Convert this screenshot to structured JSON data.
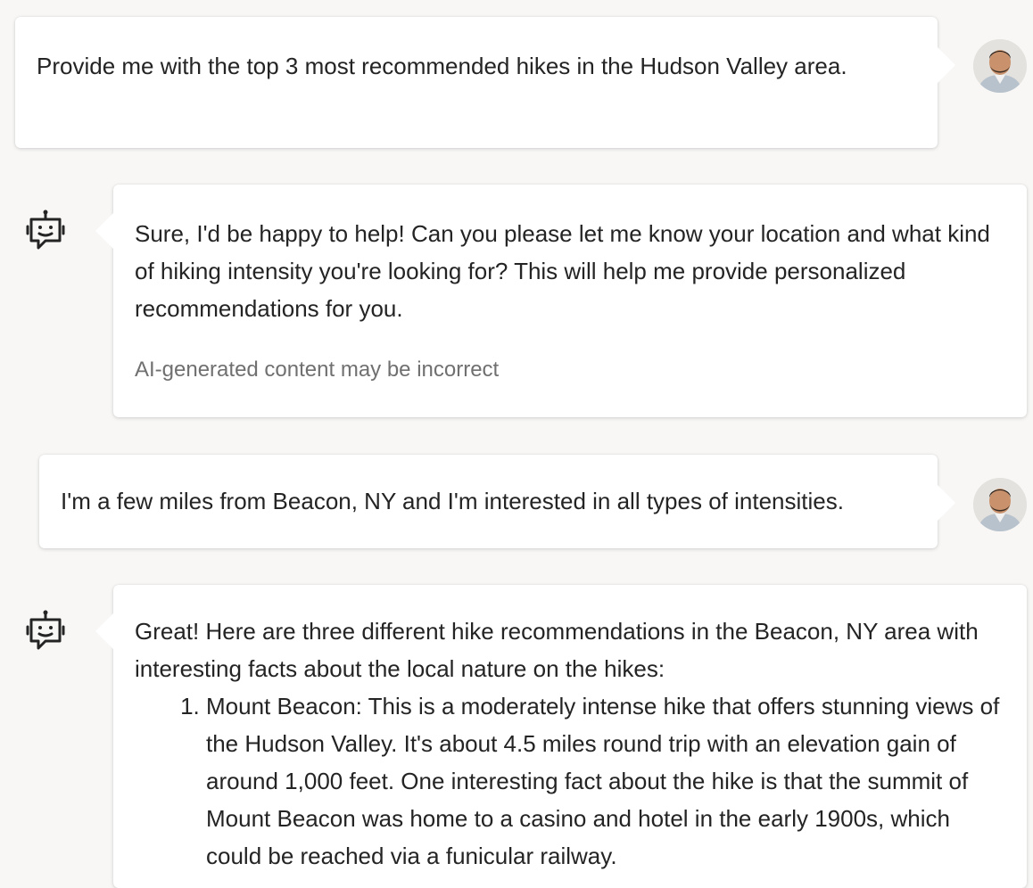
{
  "colors": {
    "background": "#f8f7f6",
    "bubble": "#ffffff",
    "text": "#242424",
    "disclaimer_text": "#707070"
  },
  "conversation": [
    {
      "role": "user",
      "avatar_icon": "user-avatar",
      "text": "Provide me with the top 3 most recommended hikes in the Hudson Valley area."
    },
    {
      "role": "bot",
      "avatar_icon": "bot-icon",
      "text": "Sure, I'd be happy to help! Can you please let me know your location and what kind of hiking intensity you're looking for? This will help me provide personalized recommendations for you.",
      "disclaimer": "AI-generated content may be incorrect"
    },
    {
      "role": "user",
      "avatar_icon": "user-avatar",
      "text": "I'm a few miles from Beacon, NY and I'm interested in all types of intensities."
    },
    {
      "role": "bot",
      "avatar_icon": "bot-icon",
      "intro": "Great! Here are three different hike recommendations in the Beacon, NY area with interesting facts about the local nature on the hikes:",
      "items": [
        "Mount Beacon: This is a moderately intense hike that offers stunning views of the Hudson Valley. It's about 4.5 miles round trip with an elevation gain of around 1,000 feet. One interesting fact about the hike is that the summit of Mount Beacon was home to a casino and hotel in the early 1900s, which could be reached via a funicular railway."
      ]
    }
  ]
}
